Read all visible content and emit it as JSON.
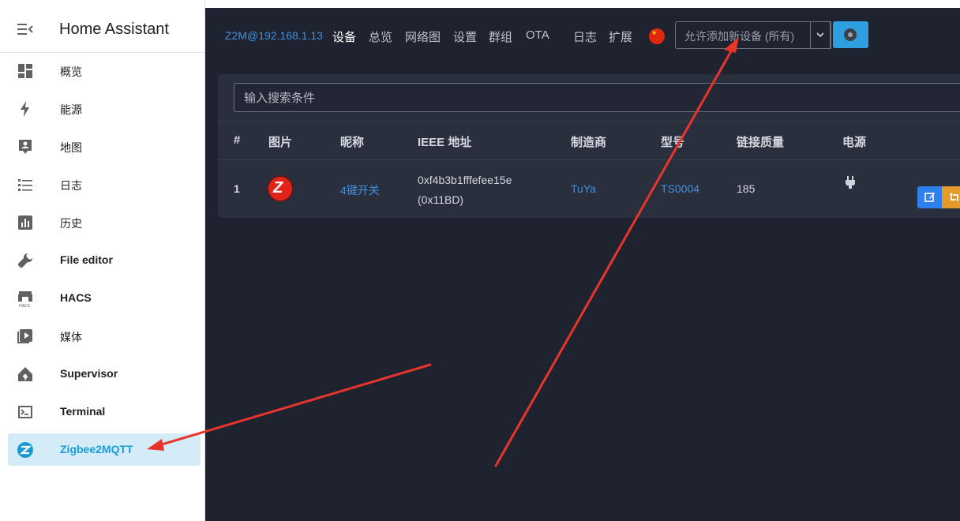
{
  "sidebar": {
    "title": "Home Assistant",
    "items": [
      {
        "label": "概览",
        "icon": "dashboard-icon"
      },
      {
        "label": "能源",
        "icon": "lightning-icon"
      },
      {
        "label": "地图",
        "icon": "map-account-icon"
      },
      {
        "label": "日志",
        "icon": "list-icon"
      },
      {
        "label": "历史",
        "icon": "chart-box-icon"
      },
      {
        "label": "File editor",
        "icon": "wrench-icon"
      },
      {
        "label": "HACS",
        "icon": "hacs-icon"
      },
      {
        "label": "媒体",
        "icon": "play-box-icon"
      },
      {
        "label": "Supervisor",
        "icon": "home-assistant-icon"
      },
      {
        "label": "Terminal",
        "icon": "console-icon"
      },
      {
        "label": "Zigbee2MQTT",
        "icon": "zigbee-icon",
        "active": true
      }
    ]
  },
  "z2m": {
    "brand": "Z2M@192.168.1.13",
    "nav": [
      "设备",
      "总览",
      "网络图",
      "设置",
      "群组",
      "OTA",
      "日志",
      "扩展"
    ],
    "active_nav": "设备",
    "permit_join": "允许添加新设备 (所有)",
    "search_placeholder": "输入搜索条件",
    "columns": [
      "#",
      "图片",
      "昵称",
      "IEEE 地址",
      "制造商",
      "型号",
      "链接质量",
      "电源"
    ],
    "devices": [
      {
        "index": "1",
        "nickname": "4键开关",
        "ieee_line1": "0xf4b3b1fffefee15e",
        "ieee_line2": "(0x11BD)",
        "manufacturer": "TuYa",
        "model": "TS0004",
        "link_quality": "185",
        "power_icon": "plug-icon",
        "image_icon": "zigbee-logo-icon"
      }
    ]
  },
  "colors": {
    "panel_bg": "#1f2330",
    "card_bg": "#2a2f3d",
    "link": "#3f90e0",
    "accent_button": "#2f9fe0",
    "edit_button": "#2f80ed",
    "rename_button": "#e59b2a",
    "active_item_bg": "#d3ecf8",
    "annotation_arrow": "#e8352b"
  }
}
